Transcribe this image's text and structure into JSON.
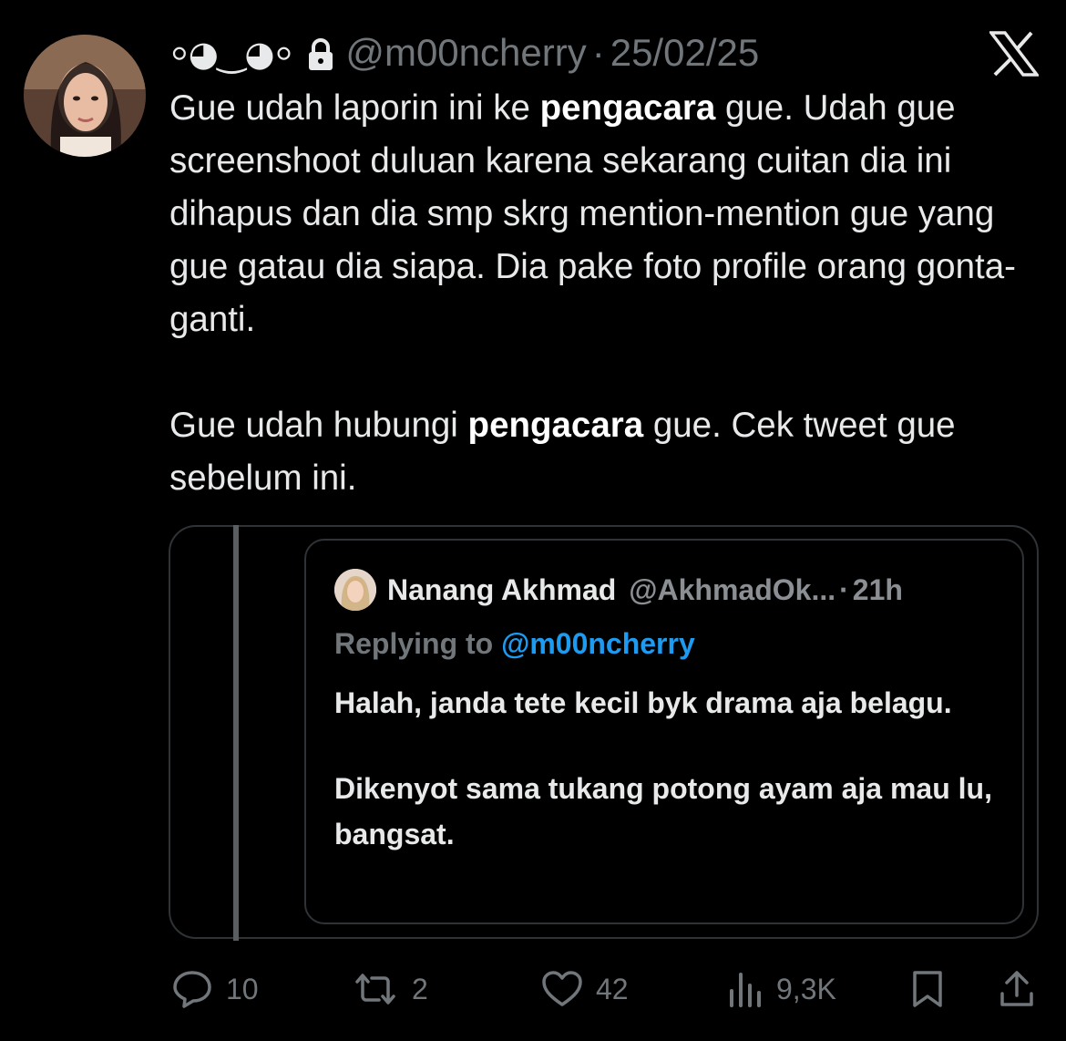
{
  "tweet": {
    "author": {
      "display_name": "⸰◕‿◕⸰",
      "handle": "@m00ncherry",
      "protected": true
    },
    "separator": "·",
    "date": "25/02/25",
    "text": {
      "p1_a": "Gue udah laporin ini ke ",
      "p1_bold": "pengacara",
      "p1_b": " gue. Udah gue screenshoot duluan karena sekarang cuitan dia ini dihapus dan dia smp skrg mention-mention gue yang gue gatau dia siapa. Dia pake foto profile orang gonta-ganti.",
      "p2_a": "Gue udah hubungi ",
      "p2_bold": "pengacara",
      "p2_b": " gue. Cek tweet gue sebelum ini."
    },
    "quoted": {
      "display_name": "Nanang Akhmad",
      "handle": "@AkhmadOk...",
      "separator": "·",
      "time": "21h",
      "replying_prefix": "Replying to ",
      "replying_mention": "@m00ncherry",
      "p1": "Halah, janda tete kecil byk drama aja belagu.",
      "p2": "Dikenyot sama tukang potong ayam aja mau lu, bangsat."
    },
    "actions": {
      "replies": "10",
      "retweets": "2",
      "likes": "42",
      "views": "9,3K"
    }
  },
  "icons": {
    "brand": "x-logo",
    "lock": "lock-icon",
    "reply": "reply-icon",
    "retweet": "retweet-icon",
    "like": "heart-icon",
    "views": "views-icon",
    "bookmark": "bookmark-icon",
    "share": "share-icon"
  },
  "colors": {
    "background": "#000000",
    "text": "#e7e9ea",
    "muted": "#71767b",
    "link": "#1d9bf0",
    "border": "#2f3336"
  }
}
